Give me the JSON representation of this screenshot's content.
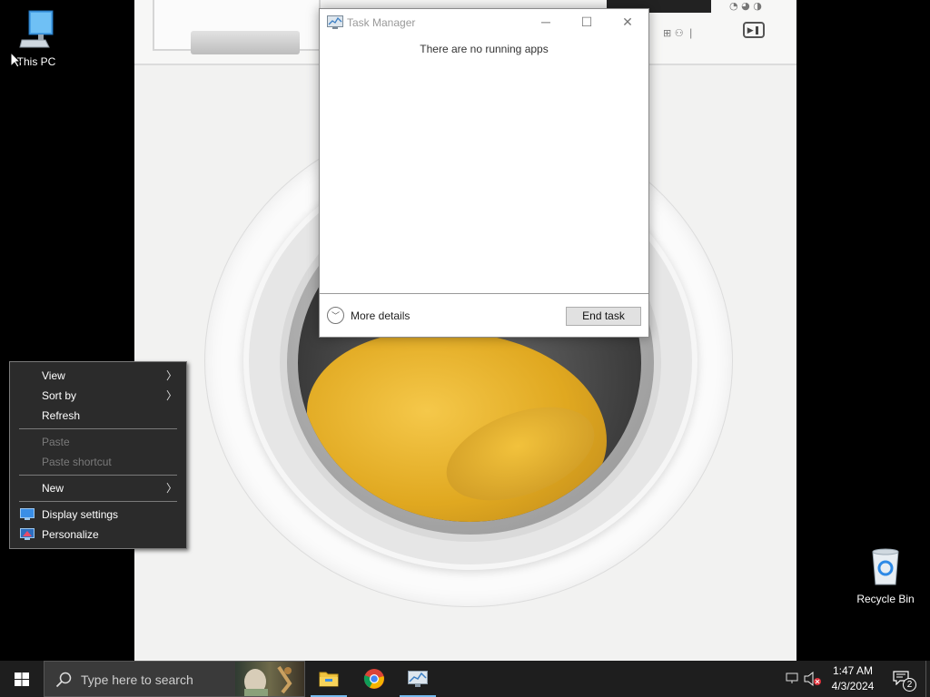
{
  "desktop_icons": {
    "this_pc": "This PC",
    "recycle_bin": "Recycle Bin"
  },
  "context_menu": {
    "view": "View",
    "sort_by": "Sort by",
    "refresh": "Refresh",
    "paste": "Paste",
    "paste_shortcut": "Paste shortcut",
    "new": "New",
    "display_settings": "Display settings",
    "personalize": "Personalize"
  },
  "task_manager": {
    "title": "Task Manager",
    "empty_message": "There are no running apps",
    "more_details": "More details",
    "end_task": "End task"
  },
  "taskbar": {
    "search_placeholder": "Type here to search",
    "time": "1:47 AM",
    "date": "4/3/2024",
    "notification_count": "2",
    "apps": [
      "file-explorer",
      "chrome",
      "task-manager"
    ]
  },
  "colors": {
    "taskbar_bg": "#1e1e1e",
    "menu_bg": "#2b2b2b",
    "accent": "#76b9ed",
    "towel": "#e0a820"
  }
}
